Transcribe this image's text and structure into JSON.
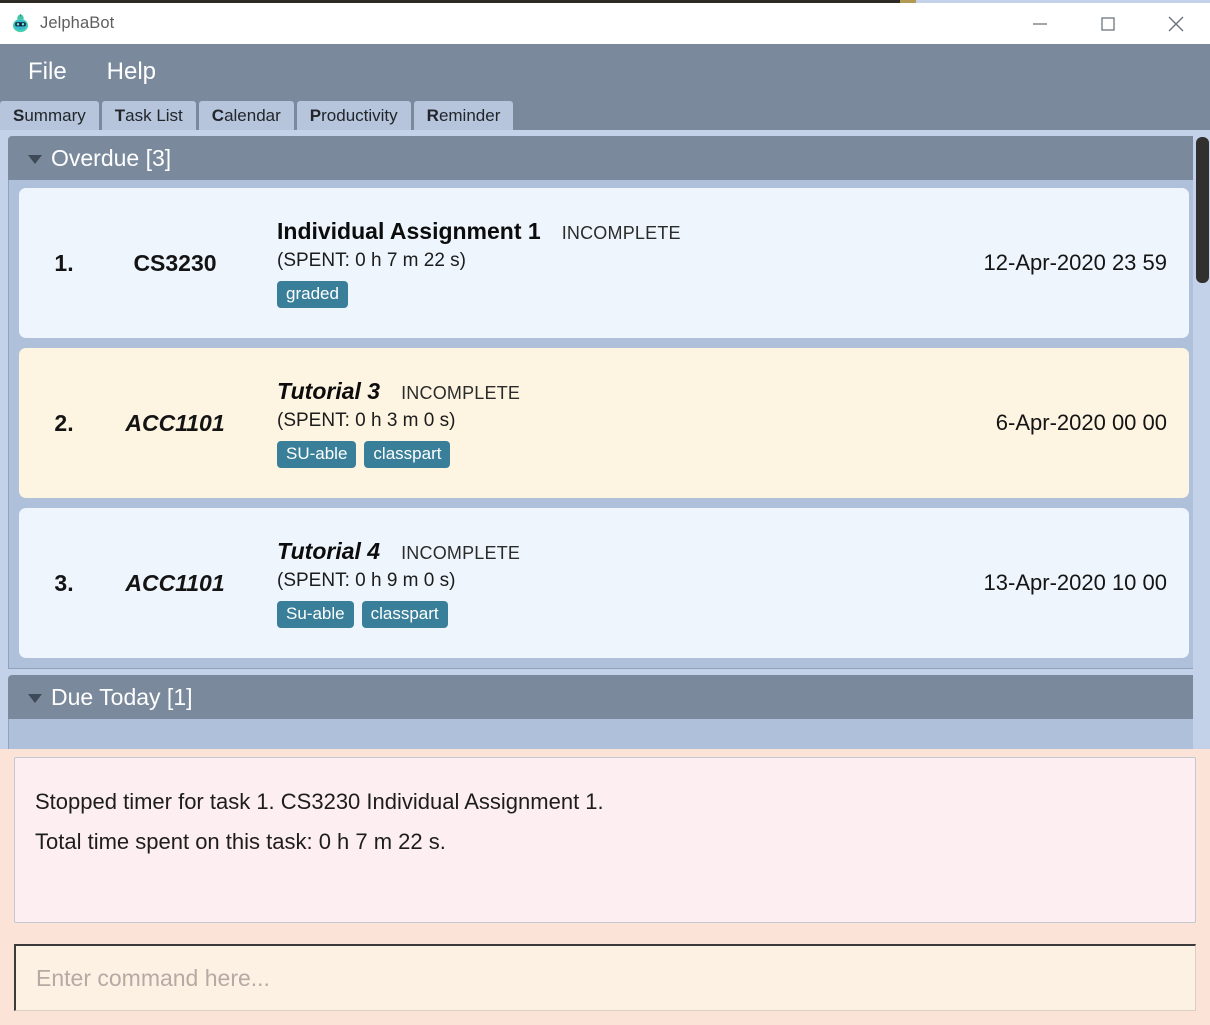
{
  "window": {
    "title": "JelphaBot",
    "logo_icon": "robot-icon",
    "controls": [
      {
        "name": "minimize",
        "icon": "minimize-icon"
      },
      {
        "name": "maximize",
        "icon": "maximize-icon"
      },
      {
        "name": "close",
        "icon": "close-icon"
      }
    ]
  },
  "menu": {
    "items": [
      {
        "label": "File"
      },
      {
        "label": "Help"
      }
    ]
  },
  "tabs": [
    {
      "mnemonic": "S",
      "rest": "ummary",
      "label": "Summary",
      "selected": true
    },
    {
      "mnemonic": "T",
      "rest": "ask List",
      "label": "Task List",
      "selected": false
    },
    {
      "mnemonic": "C",
      "rest": "alendar",
      "label": "Calendar",
      "selected": false
    },
    {
      "mnemonic": "P",
      "rest": "roductivity",
      "label": "Productivity",
      "selected": false
    },
    {
      "mnemonic": "R",
      "rest": "eminder",
      "label": "Reminder",
      "selected": false
    }
  ],
  "sections": [
    {
      "title": "Overdue [3]",
      "caret_icon": "chevron-down-icon",
      "count": 3,
      "tasks": [
        {
          "index": "1.",
          "module": "CS3230",
          "name": "Individual Assignment 1",
          "status": "INCOMPLETE",
          "spent": "(SPENT: 0 h 7 m 22 s)",
          "tags": [
            "graded"
          ],
          "date": "12-Apr-2020 23 59",
          "style": "blue",
          "italic": false
        },
        {
          "index": "2.",
          "module": "ACC1101",
          "name": "Tutorial 3",
          "status": "INCOMPLETE",
          "spent": "(SPENT: 0 h 3 m 0 s)",
          "tags": [
            "SU-able",
            "classpart"
          ],
          "date": "6-Apr-2020 00 00",
          "style": "cream",
          "italic": true
        },
        {
          "index": "3.",
          "module": "ACC1101",
          "name": "Tutorial 4",
          "status": "INCOMPLETE",
          "spent": "(SPENT: 0 h 9 m 0 s)",
          "tags": [
            "Su-able",
            "classpart"
          ],
          "date": "13-Apr-2020 10 00",
          "style": "blue",
          "italic": true
        }
      ]
    },
    {
      "title": "Due Today [1]",
      "caret_icon": "chevron-down-icon",
      "count": 1,
      "tasks": []
    }
  ],
  "result": {
    "lines": [
      "Stopped timer for task 1. CS3230 Individual Assignment 1.",
      "Total time spent on this task: 0 h 7 m 22 s."
    ]
  },
  "command": {
    "value": "",
    "placeholder": "Enter command here..."
  },
  "scrollbar": {
    "orientation": "vertical",
    "thumb_position_percent": 1
  },
  "colors": {
    "window_chrome": "#7a8a9c",
    "tab_bg": "#b6c5dc",
    "panel_bg": "#c3d2e8",
    "section_body": "#aec0da",
    "card_blue": "#eef5fd",
    "card_cream": "#fdf4e1",
    "tag_bg": "#3a7f99",
    "result_bg": "#fdeef1",
    "command_bg": "#fdf1e3",
    "bottom_bg": "#fbe3d7"
  }
}
